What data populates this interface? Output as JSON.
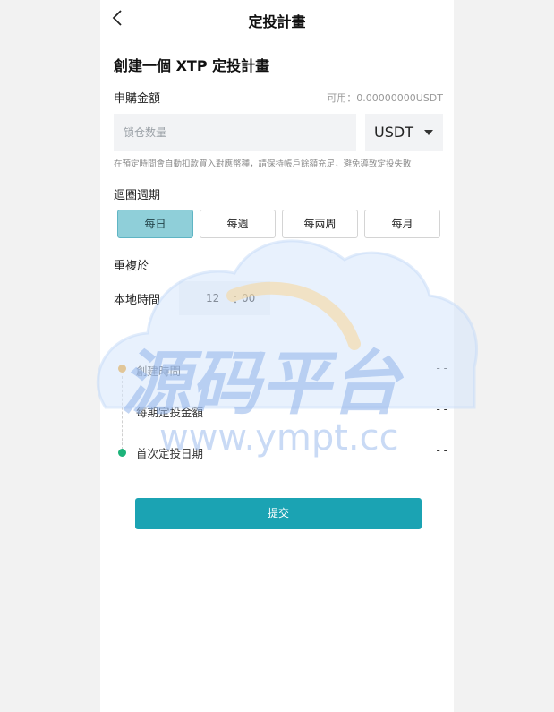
{
  "nav": {
    "title": "定投計畫",
    "back_icon": "chevron-left-icon"
  },
  "form": {
    "heading": "創建一個 XTP 定投計畫",
    "amount_label": "申購金額",
    "available": "可用：0.00000000USDT",
    "amount_placeholder": "锁仓数量",
    "amount_value": "",
    "currency": "USDT",
    "hint": "在預定時間會自動扣款買入對應幣種，請保持帳戶餘額充足，避免導致定投失敗",
    "cycle_label": "迴圈週期",
    "cycle_options": [
      "每日",
      "每週",
      "每兩周",
      "每月"
    ],
    "cycle_selected": "每日",
    "repeat_label": "重複於",
    "local_time_label": "本地時間",
    "time_hour": "12",
    "time_sep": "：",
    "time_minute": "00"
  },
  "timeline": [
    {
      "label": "創建時間",
      "value": "- -",
      "dot_color": "#f0a020"
    },
    {
      "label": "每期定投金額",
      "value": "- -",
      "dot_color": ""
    },
    {
      "label": "首次定投日期",
      "value": "- -",
      "dot_color": "#1db37a"
    }
  ],
  "submit_label": "提交",
  "watermark": {
    "text": "源码平台",
    "url": "www.ympt.cc"
  },
  "colors": {
    "accent": "#1ba3b3",
    "selected": "#8fcfd9"
  }
}
